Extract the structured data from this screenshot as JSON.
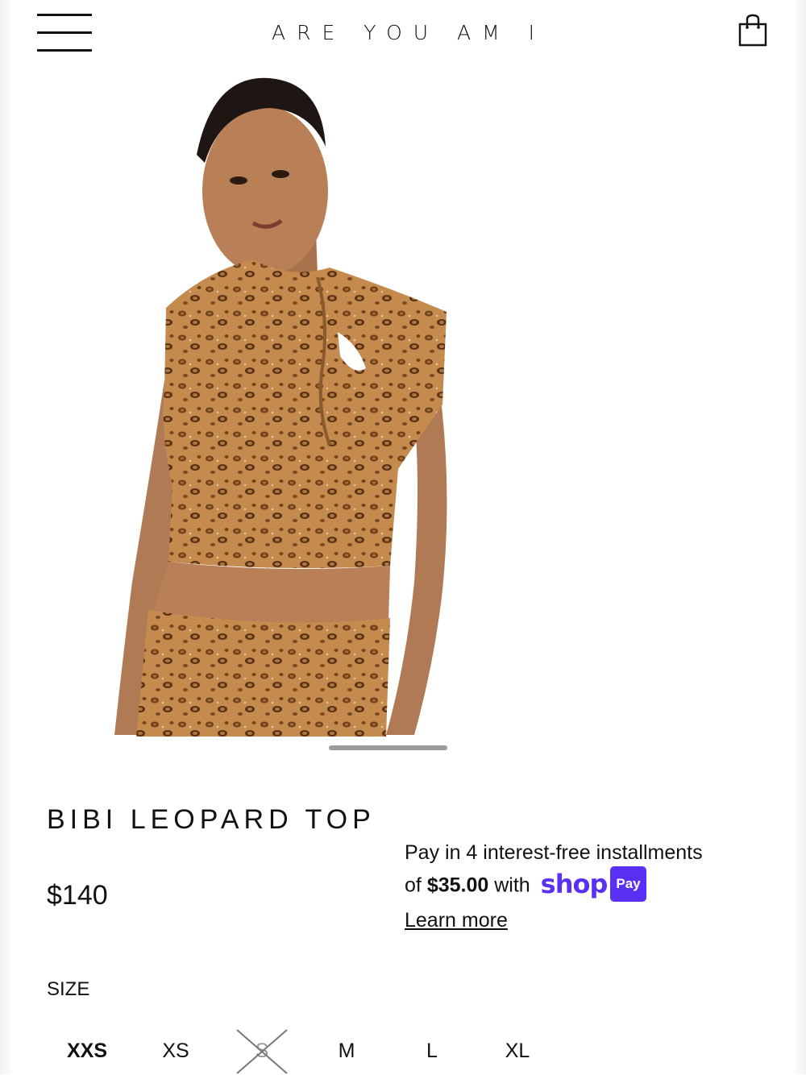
{
  "header": {
    "brand": "ARE YOU AM I"
  },
  "product": {
    "title": "BIBI LEOPARD TOP",
    "price": "$140"
  },
  "installments": {
    "line1": "Pay in 4 interest-free installments",
    "of_text": "of",
    "amount": "$35.00",
    "with_text": "with",
    "shop_logo": "shop",
    "pay_badge": "Pay",
    "learn_more": "Learn more"
  },
  "size_section": {
    "label": "SIZE",
    "options": [
      {
        "label": "XXS",
        "selected": true,
        "available": true
      },
      {
        "label": "XS",
        "selected": false,
        "available": true
      },
      {
        "label": "S",
        "selected": false,
        "available": false
      },
      {
        "label": "M",
        "selected": false,
        "available": true
      },
      {
        "label": "L",
        "selected": false,
        "available": true
      },
      {
        "label": "XL",
        "selected": false,
        "available": true
      }
    ]
  },
  "colors": {
    "shop_pay_purple": "#5a31f4",
    "text": "#111111",
    "indicator": "#9a9a9a"
  }
}
